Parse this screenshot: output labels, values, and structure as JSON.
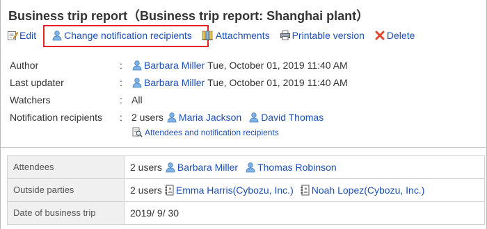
{
  "page": {
    "title": "Business trip report（Business trip report: Shanghai plant）"
  },
  "toolbar": {
    "edit": {
      "label": "Edit",
      "icon": "edit-icon"
    },
    "change_notification": {
      "label": "Change notification recipients",
      "icon": "user-icon"
    },
    "attachments": {
      "label": "Attachments",
      "icon": "attachment-icon"
    },
    "printable": {
      "label": "Printable version",
      "icon": "printer-icon"
    },
    "delete": {
      "label": "Delete",
      "icon": "delete-x-icon"
    },
    "highlight_color": "#e52222"
  },
  "info": {
    "colon": ":",
    "author": {
      "label": "Author",
      "user": "Barbara Miller",
      "timestamp": "Tue, October 01, 2019 11:40 AM"
    },
    "last_updater": {
      "label": "Last updater",
      "user": "Barbara Miller",
      "timestamp": "Tue, October 01, 2019 11:40 AM"
    },
    "watchers": {
      "label": "Watchers",
      "value": "All"
    },
    "notification_recipients": {
      "label": "Notification recipients",
      "count": "2 users",
      "users": [
        "Maria Jackson",
        "David Thomas"
      ]
    },
    "attendees_link": "Attendees and notification recipients"
  },
  "table": {
    "attendees": {
      "label": "Attendees",
      "count": "2 users",
      "users": [
        "Barbara Miller",
        "Thomas Robinson"
      ]
    },
    "outside_parties": {
      "label": "Outside parties",
      "count": "2 users",
      "users": [
        "Emma Harris(Cybozu, Inc.)",
        "Noah Lopez(Cybozu, Inc.)"
      ]
    },
    "date": {
      "label": "Date of business trip",
      "value": "2019/ 9/ 30"
    }
  },
  "colors": {
    "link": "#1c4fb3",
    "user_icon": "#5b9bd5",
    "header_bg": "#f0f0f0"
  }
}
